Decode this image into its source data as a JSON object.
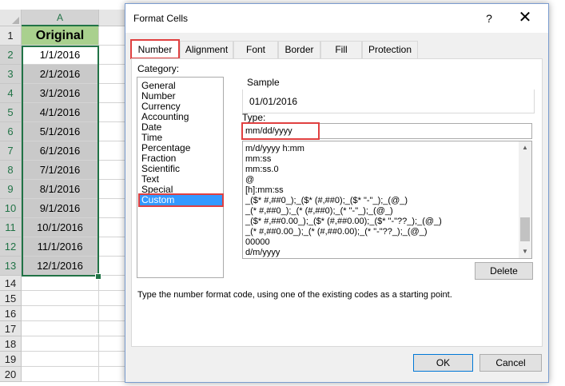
{
  "spreadsheet": {
    "column_header": "A",
    "row_numbers": [
      "1",
      "2",
      "3",
      "4",
      "5",
      "6",
      "7",
      "8",
      "9",
      "10",
      "11",
      "12",
      "13",
      "14",
      "15",
      "16",
      "17",
      "18",
      "19",
      "20"
    ],
    "header_cell": "Original",
    "values": [
      "1/1/2016",
      "2/1/2016",
      "3/1/2016",
      "4/1/2016",
      "5/1/2016",
      "6/1/2016",
      "7/1/2016",
      "8/1/2016",
      "9/1/2016",
      "10/1/2016",
      "11/1/2016",
      "12/1/2016"
    ],
    "colors": {
      "header_fill": "#a9d08e",
      "shaded_fill": "#c9c9c9",
      "selection": "#217346"
    }
  },
  "dialog": {
    "title": "Format Cells",
    "help_glyph": "?",
    "close_glyph": "✕",
    "tabs": [
      "Number",
      "Alignment",
      "Font",
      "Border",
      "Fill",
      "Protection"
    ],
    "active_tab": "Number",
    "category_label": "Category:",
    "categories": [
      "General",
      "Number",
      "Currency",
      "Accounting",
      "Date",
      "Time",
      "Percentage",
      "Fraction",
      "Scientific",
      "Text",
      "Special",
      "Custom"
    ],
    "selected_category": "Custom",
    "sample_label": "Sample",
    "sample_value": "01/01/2016",
    "type_label": "Type:",
    "type_value": "mm/dd/yyyy",
    "format_codes": [
      "m/d/yyyy h:mm",
      "mm:ss",
      "mm:ss.0",
      "@",
      "[h]:mm:ss",
      "_($* #,##0_);_($* (#,##0);_($* \"-\"_);_(@_)",
      "_(* #,##0_);_(* (#,##0);_(* \"-\"_);_(@_)",
      "_($* #,##0.00_);_($* (#,##0.00);_($* \"-\"??_);_(@_)",
      "_(* #,##0.00_);_(* (#,##0.00);_(* \"-\"??_);_(@_)",
      "00000",
      "d/m/yyyy"
    ],
    "delete_label": "Delete",
    "description": "Type the number format code, using one of the existing codes as a starting point.",
    "ok_label": "OK",
    "cancel_label": "Cancel",
    "colors": {
      "highlight_outline": "#e04040",
      "selected_item": "#3399ff"
    }
  }
}
